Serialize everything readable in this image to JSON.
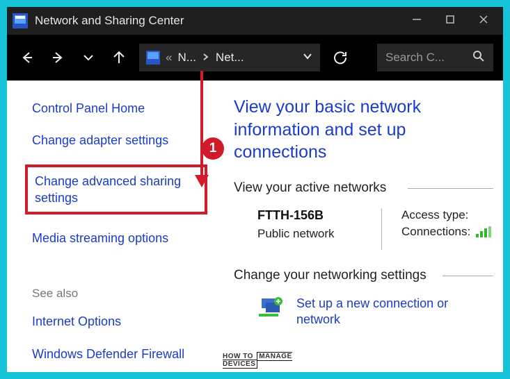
{
  "titlebar": {
    "title": "Network and Sharing Center"
  },
  "address": {
    "seg1": "N...",
    "seg2": "Net..."
  },
  "search": {
    "placeholder": "Search C..."
  },
  "sidebar": {
    "home": "Control Panel Home",
    "adapter": "Change adapter settings",
    "advanced": "Change advanced sharing settings",
    "media": "Media streaming options",
    "seealso_header": "See also",
    "internet_options": "Internet Options",
    "defender": "Windows Defender Firewall"
  },
  "main": {
    "heading": "View your basic network information and set up connections",
    "active_title": "View your active networks",
    "network": {
      "name": "FTTH-156B",
      "type": "Public network",
      "access_label": "Access type:",
      "connections_label": "Connections:"
    },
    "change_title": "Change your networking settings",
    "setup_link": "Set up a new connection or network"
  },
  "callout": {
    "number": "1"
  },
  "watermark": {
    "left": "HOW TO",
    "mid": "MANAGE",
    "right": "DEVICES"
  }
}
